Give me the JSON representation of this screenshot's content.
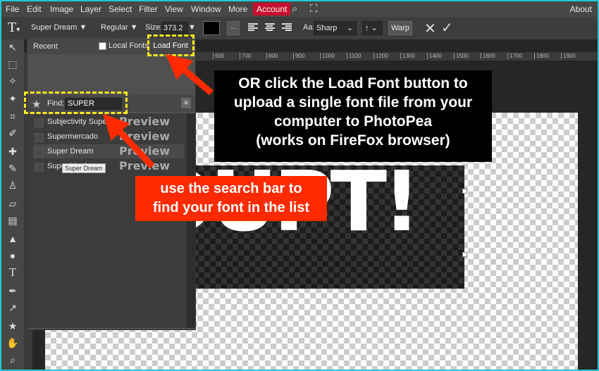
{
  "menubar": {
    "items": [
      "File",
      "Edit",
      "Image",
      "Layer",
      "Select",
      "Filter",
      "View",
      "Window",
      "More"
    ],
    "account": "Account",
    "about": "About",
    "search_icon": "search-icon",
    "fullscreen_icon": "fullscreen-icon"
  },
  "options": {
    "tool_icon": "T",
    "font_family": "Super Dream ▼",
    "font_style": "Regular ▼",
    "size_label": "Size:",
    "size_value": "373.2",
    "size_arrow": "▼",
    "dots": "...",
    "aa_label": "Aa:",
    "aa_value": "Sharp",
    "aa_arrow": "⌄",
    "direction": "↑ ⌄",
    "warp": "Warp",
    "text_color": "#000000"
  },
  "ruler": {
    "ticks": [
      "600",
      "700",
      "800",
      "900",
      "1000",
      "1100",
      "1200",
      "1300",
      "1400",
      "1500",
      "1600",
      "1700",
      "1800",
      "1900"
    ]
  },
  "font_panel": {
    "recent_tab": "Recent",
    "local_fonts": "Local Fonts",
    "load_font": "Load Font",
    "find_label": "Find:",
    "find_value": "SUPER",
    "menu": "≡",
    "fonts": [
      {
        "name": "Subjectivity Super",
        "preview": "Preview"
      },
      {
        "name": "Supermercado",
        "preview": "Preview"
      },
      {
        "name": "Super Dream",
        "preview": "Preview"
      },
      {
        "name": "Super Magic",
        "preview": "Preview"
      }
    ],
    "tooltip": "Super Dream"
  },
  "canvas": {
    "layer_text": "OUPT!"
  },
  "annotations": {
    "black_callout": [
      "OR click the Load Font button to",
      "upload a single font file from your",
      "computer to PhotoPea",
      "(works on FireFox browser)"
    ],
    "red_callout": [
      "use the search bar to",
      "find your font in the list"
    ],
    "highlight_color": "#ffe81a",
    "arrow_color": "#ff2a00"
  }
}
